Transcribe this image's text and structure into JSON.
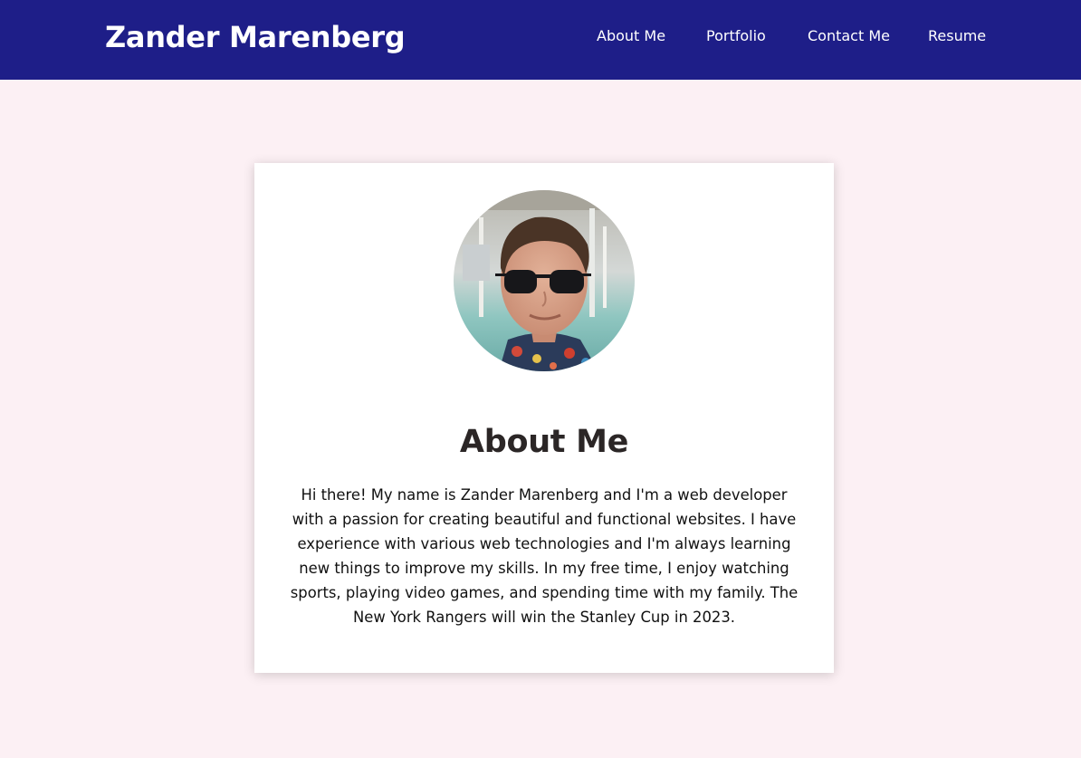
{
  "header": {
    "site_title": "Zander Marenberg",
    "background_color": "#1e1e88",
    "nav": [
      {
        "label": "About Me"
      },
      {
        "label": "Portfolio"
      },
      {
        "label": "Contact Me"
      },
      {
        "label": "Resume"
      }
    ]
  },
  "page": {
    "background_color": "#fcf0f4"
  },
  "about": {
    "avatar_alt": "profile-photo",
    "title": "About Me",
    "body": "Hi there! My name is Zander Marenberg and I'm a web developer with a passion for creating beautiful and functional websites. I have experience with various web technologies and I'm always learning new things to improve my skills. In my free time, I enjoy watching sports, playing video games, and spending time with my family. The New York Rangers will win the Stanley Cup in 2023."
  }
}
